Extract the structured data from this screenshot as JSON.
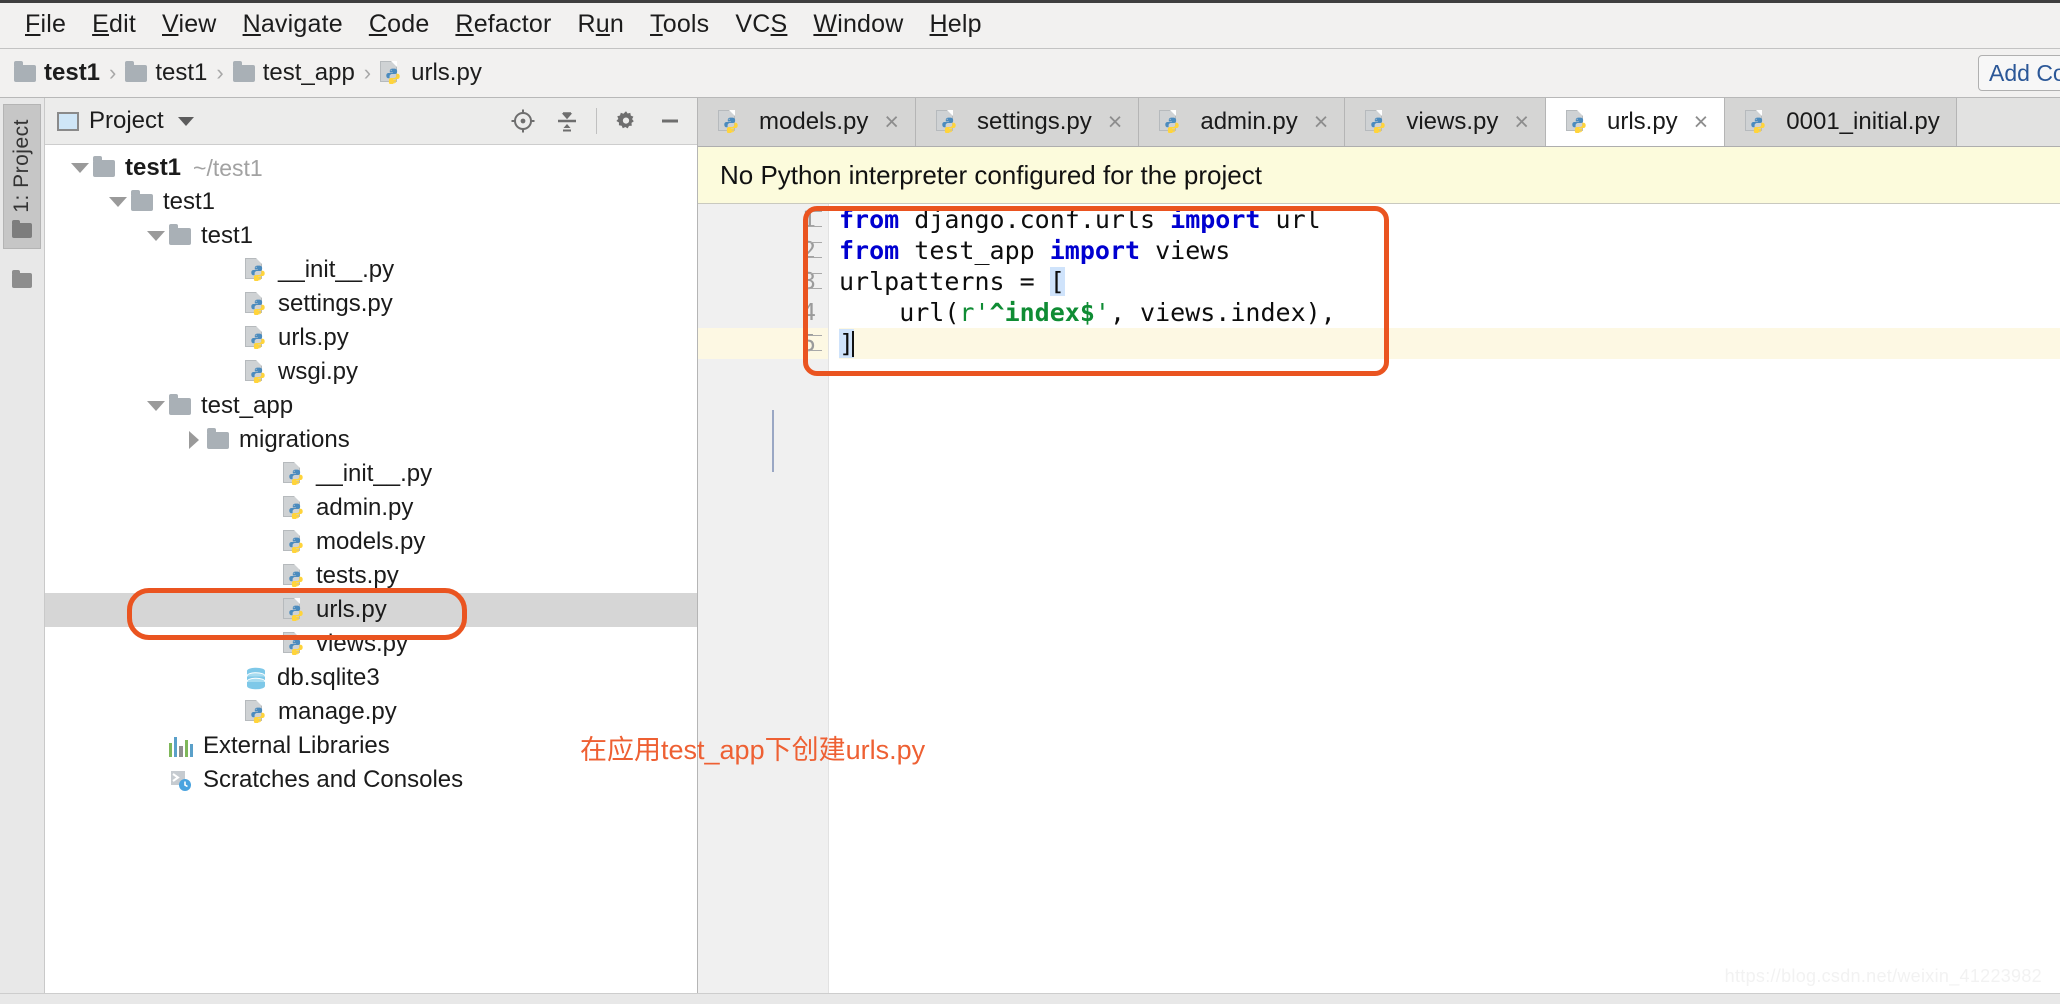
{
  "app": {
    "menu": [
      {
        "label": "File",
        "mnemonic": "F"
      },
      {
        "label": "Edit",
        "mnemonic": "E"
      },
      {
        "label": "View",
        "mnemonic": "V"
      },
      {
        "label": "Navigate",
        "mnemonic": "N"
      },
      {
        "label": "Code",
        "mnemonic": "C"
      },
      {
        "label": "Refactor",
        "mnemonic": "R"
      },
      {
        "label": "Run",
        "mnemonic": "u"
      },
      {
        "label": "Tools",
        "mnemonic": "T"
      },
      {
        "label": "VCS",
        "mnemonic": "S"
      },
      {
        "label": "Window",
        "mnemonic": "W"
      },
      {
        "label": "Help",
        "mnemonic": "H"
      }
    ]
  },
  "breadcrumb": {
    "items": [
      {
        "label": "test1",
        "icon": "folder-icon",
        "bold": true
      },
      {
        "label": "test1",
        "icon": "folder-icon",
        "bold": false
      },
      {
        "label": "test_app",
        "icon": "folder-icon",
        "bold": false
      },
      {
        "label": "urls.py",
        "icon": "python-file-icon",
        "bold": false
      }
    ],
    "separator": "›",
    "add_config_label": "Add Configuration..."
  },
  "toolstrip": {
    "project_tab_label": "1: Project",
    "project_tab_icon": "folder-icon",
    "bottom_icon": "folder-icon"
  },
  "project_panel": {
    "title": "Project",
    "title_icon": "window-icon",
    "dropdown_icon": "chevron-down-icon",
    "tools": [
      {
        "name": "locate-icon",
        "title": "Select Opened File"
      },
      {
        "name": "collapse-all-icon",
        "title": "Collapse All"
      },
      {
        "name": "gear-icon",
        "title": "Settings"
      },
      {
        "name": "minimize-icon",
        "title": "Hide"
      }
    ],
    "tree": [
      {
        "label": "test1",
        "sub": "~/test1",
        "icon": "folder-icon",
        "indent": 0,
        "arrow": "down",
        "bold": true,
        "selected": false
      },
      {
        "label": "test1",
        "sub": "",
        "icon": "folder-icon",
        "indent": 1,
        "arrow": "down",
        "bold": false,
        "selected": false
      },
      {
        "label": "test1",
        "sub": "",
        "icon": "folder-icon",
        "indent": 2,
        "arrow": "down",
        "bold": false,
        "selected": false
      },
      {
        "label": "__init__.py",
        "sub": "",
        "icon": "python-file-icon",
        "indent": 4,
        "arrow": "none",
        "bold": false,
        "selected": false
      },
      {
        "label": "settings.py",
        "sub": "",
        "icon": "python-file-icon",
        "indent": 4,
        "arrow": "none",
        "bold": false,
        "selected": false
      },
      {
        "label": "urls.py",
        "sub": "",
        "icon": "python-file-icon",
        "indent": 4,
        "arrow": "none",
        "bold": false,
        "selected": false
      },
      {
        "label": "wsgi.py",
        "sub": "",
        "icon": "python-file-icon",
        "indent": 4,
        "arrow": "none",
        "bold": false,
        "selected": false
      },
      {
        "label": "test_app",
        "sub": "",
        "icon": "folder-icon",
        "indent": 2,
        "arrow": "down",
        "bold": false,
        "selected": false
      },
      {
        "label": "migrations",
        "sub": "",
        "icon": "folder-icon",
        "indent": 3,
        "arrow": "right",
        "bold": false,
        "selected": false
      },
      {
        "label": "__init__.py",
        "sub": "",
        "icon": "python-file-icon",
        "indent": 5,
        "arrow": "none",
        "bold": false,
        "selected": false
      },
      {
        "label": "admin.py",
        "sub": "",
        "icon": "python-file-icon",
        "indent": 5,
        "arrow": "none",
        "bold": false,
        "selected": false
      },
      {
        "label": "models.py",
        "sub": "",
        "icon": "python-file-icon",
        "indent": 5,
        "arrow": "none",
        "bold": false,
        "selected": false
      },
      {
        "label": "tests.py",
        "sub": "",
        "icon": "python-file-icon",
        "indent": 5,
        "arrow": "none",
        "bold": false,
        "selected": false
      },
      {
        "label": "urls.py",
        "sub": "",
        "icon": "python-file-icon",
        "indent": 5,
        "arrow": "none",
        "bold": false,
        "selected": true
      },
      {
        "label": "views.py",
        "sub": "",
        "icon": "python-file-icon",
        "indent": 5,
        "arrow": "none",
        "bold": false,
        "selected": false
      },
      {
        "label": "db.sqlite3",
        "sub": "",
        "icon": "database-icon",
        "indent": 4,
        "arrow": "none",
        "bold": false,
        "selected": false
      },
      {
        "label": "manage.py",
        "sub": "",
        "icon": "python-file-icon",
        "indent": 4,
        "arrow": "none",
        "bold": false,
        "selected": false
      },
      {
        "label": "External Libraries",
        "sub": "",
        "icon": "library-icon",
        "indent": 2,
        "arrow": "none",
        "bold": false,
        "selected": false
      },
      {
        "label": "Scratches and Consoles",
        "sub": "",
        "icon": "scratches-icon",
        "indent": 2,
        "arrow": "none",
        "bold": false,
        "selected": false
      }
    ]
  },
  "annotation": {
    "text": "在应用test_app下创建urls.py",
    "color": "#ee6033"
  },
  "editor": {
    "tabs": [
      {
        "label": "models.py",
        "icon": "python-file-icon",
        "active": false,
        "closable": true
      },
      {
        "label": "settings.py",
        "icon": "python-file-icon",
        "active": false,
        "closable": true
      },
      {
        "label": "admin.py",
        "icon": "python-file-icon",
        "active": false,
        "closable": true
      },
      {
        "label": "views.py",
        "icon": "python-file-icon",
        "active": false,
        "closable": true
      },
      {
        "label": "urls.py",
        "icon": "python-file-icon",
        "active": true,
        "closable": true
      },
      {
        "label": "0001_initial.py",
        "icon": "python-file-icon",
        "active": false,
        "closable": false
      }
    ],
    "close_glyph": "×",
    "warning_banner": "No Python interpreter configured for the project",
    "line_numbers": [
      "1",
      "2",
      "3",
      "4",
      "5"
    ],
    "current_line": 5,
    "code_lines": [
      {
        "n": 1,
        "text": "from django.conf.urls import url"
      },
      {
        "n": 2,
        "text": "from test_app import views"
      },
      {
        "n": 3,
        "text": "urlpatterns = ["
      },
      {
        "n": 4,
        "text": "    url(r'^index$', views.index),"
      },
      {
        "n": 5,
        "text": "]"
      }
    ],
    "highlight_color": "#ea5420"
  },
  "watermark": "https://blog.csdn.net/weixin_41223982",
  "colors": {
    "accent_orange": "#ea5420",
    "keyword_blue": "#0000d0",
    "string_green": "#0f8c34",
    "warning_bg": "#fcfbdc",
    "selection_gray": "#d6d6d6",
    "current_line_bg": "#fdf8e3"
  }
}
